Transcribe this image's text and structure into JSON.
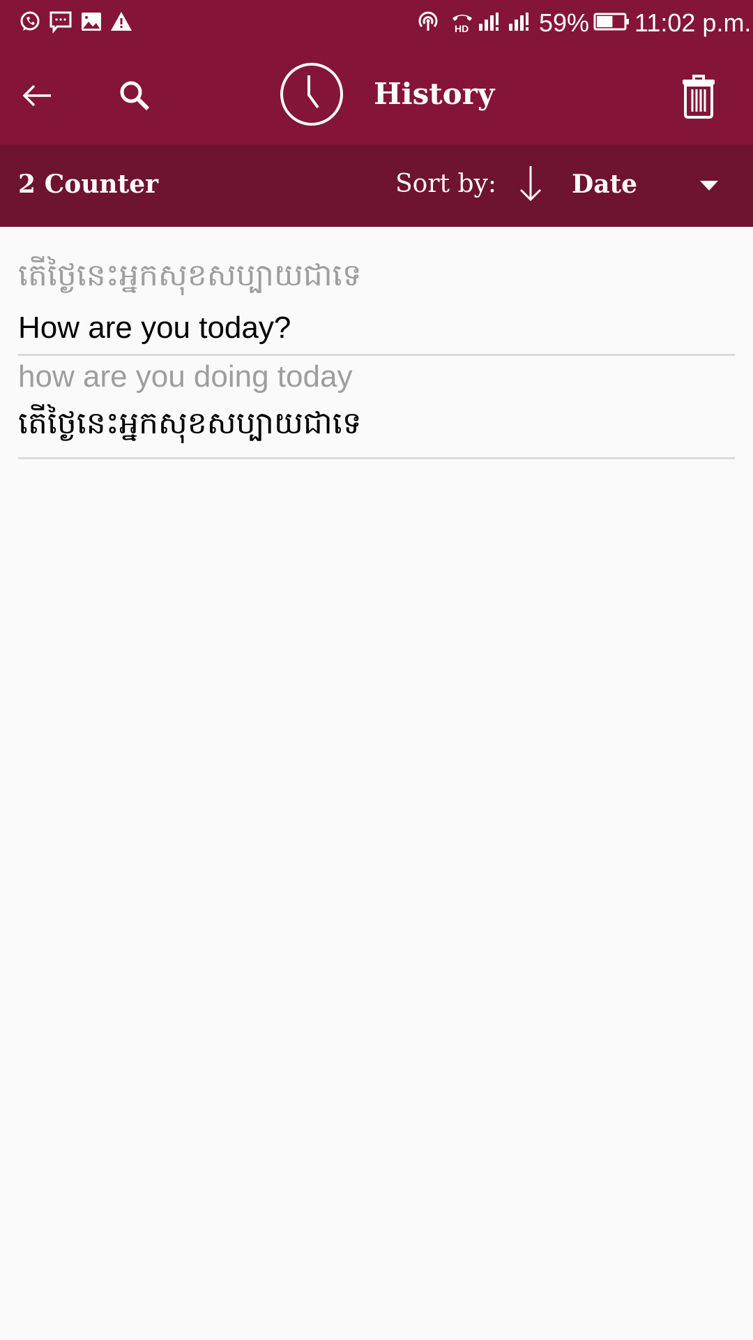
{
  "status_bar": {
    "left_icons": [
      "whatsapp-icon",
      "message-icon",
      "image-icon",
      "warning-icon"
    ],
    "right_icons": [
      "hotspot-icon",
      "hd-call-icon",
      "signal-sim1-icon",
      "signal-sim2-icon"
    ],
    "battery_percent": "59%",
    "battery_level": 0.59,
    "time": "11:02 p.m."
  },
  "toolbar": {
    "title": "History",
    "back_icon": "arrow-left-icon",
    "search_icon": "search-icon",
    "title_icon": "clock-icon",
    "delete_icon": "trash-icon"
  },
  "sort_bar": {
    "counter": "2 Counter",
    "sort_label": "Sort by:",
    "sort_direction_icon": "arrow-down-icon",
    "sort_value": "Date",
    "dropdown_icon": "caret-down-icon"
  },
  "history": [
    {
      "source": "តើថ្ងៃនេះអ្នកសុខសប្បាយជាទេ",
      "translation": "How are you today?"
    },
    {
      "source": "how are you doing today",
      "translation": "តើថ្ងៃនេះអ្នកសុខសប្បាយជាទេ"
    }
  ],
  "colors": {
    "primary": "#841538",
    "primary_dark": "#6e1330",
    "background": "#fafafa",
    "divider": "#dadada",
    "secondary_text": "#9e9e9e"
  }
}
